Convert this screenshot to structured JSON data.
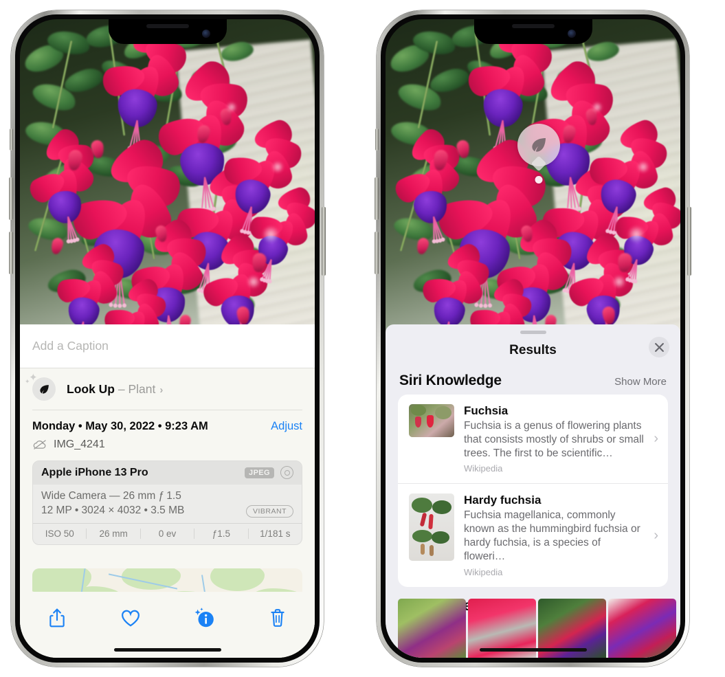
{
  "left_phone": {
    "caption_field": {
      "placeholder": "Add a Caption",
      "value": ""
    },
    "lookup_row": {
      "icon": "leaf-icon",
      "label": "Look Up",
      "dash": " – ",
      "subject": "Plant",
      "chevron": "›"
    },
    "date_row": {
      "date_text": "Monday • May 30, 2022 • 9:23 AM",
      "adjust_label": "Adjust"
    },
    "file_row": {
      "icon": "icloud-slash-icon",
      "filename": "IMG_4241"
    },
    "exif": {
      "device": "Apple iPhone 13 Pro",
      "format_badge": "JPEG",
      "hdr_icon": "hdr-ring-icon",
      "lens_line": "Wide Camera — 26 mm ƒ 1.5",
      "specs_line": "12 MP • 3024 × 4032 • 3.5 MB",
      "style_badge": "VIBRANT",
      "stats": [
        "ISO 50",
        "26 mm",
        "0 ev",
        "ƒ1.5",
        "1/181 s"
      ]
    },
    "toolbar": [
      {
        "name": "share-icon",
        "label": "Share"
      },
      {
        "name": "heart-icon",
        "label": "Favorite"
      },
      {
        "name": "info-sparkle-icon",
        "label": "Info"
      },
      {
        "name": "trash-icon",
        "label": "Delete"
      }
    ]
  },
  "right_phone": {
    "lookup_bubble": {
      "icon": "leaf-icon"
    },
    "sheet": {
      "title": "Results",
      "close_icon": "close-icon",
      "sections": [
        {
          "title": "Siri Knowledge",
          "action": "Show More",
          "items": [
            {
              "title": "Fuchsia",
              "description": "Fuchsia is a genus of flowering plants that consists mostly of shrubs or small trees. The first to be scientific…",
              "source": "Wikipedia",
              "chevron": "›"
            },
            {
              "title": "Hardy fuchsia",
              "description": "Fuchsia magellanica, commonly known as the hummingbird fuchsia or hardy fuchsia, is a species of floweri…",
              "source": "Wikipedia",
              "chevron": "›"
            }
          ]
        },
        {
          "title": "Similar Web Images",
          "action": "",
          "thumbnails": [
            "web-image-1",
            "web-image-2",
            "web-image-3",
            "web-image-4"
          ]
        }
      ]
    }
  },
  "colors": {
    "accent_blue": "#1b82f5",
    "sheet_bg_left": "#f7f7f2",
    "sheet_bg_right": "#eeeef3",
    "card_white": "#ffffff",
    "text_primary": "#0c0c0c",
    "text_secondary": "#6a6a6e",
    "text_tertiary": "#a9a9ae"
  }
}
